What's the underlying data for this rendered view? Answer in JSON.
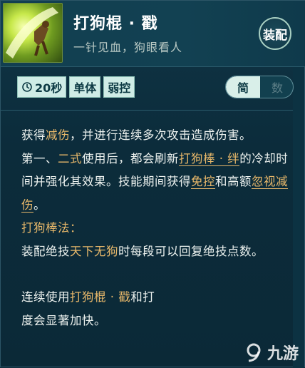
{
  "skill": {
    "name": "打狗棍 · 戳",
    "subtitle": "一针见血，狗眼看人",
    "equip_label": "装配",
    "icon": "dog-staff-skill-icon"
  },
  "tags": [
    {
      "label": "20秒",
      "icon": "cooldown-clock-icon"
    },
    {
      "label": "单体"
    },
    {
      "label": "弱控"
    }
  ],
  "toggle": {
    "active": "简",
    "inactive": "数"
  },
  "description": {
    "p1": [
      "获得",
      "减伤",
      "，并进行连续多次攻击造成伤害。"
    ],
    "p2": [
      "第一、",
      "二式",
      "使用后，都会刷新",
      "打狗棒 · 绊",
      "的冷却时间并强化其效果。技能期间获得",
      "免控",
      "和高额",
      "忽视减伤",
      "。"
    ],
    "section_title": "打狗棒法：",
    "p3": [
      "装配绝技",
      "天下无狗",
      "时每段可以回复绝技点数。"
    ],
    "p4": [
      "连续使用",
      "打狗棍 · 戳",
      "和打",
      "度会显著加快。"
    ]
  },
  "watermark": {
    "text": "九游",
    "icon": "9you-logo-icon"
  },
  "colors": {
    "highlight": "#e8b86a",
    "panel": "#0f3546"
  }
}
